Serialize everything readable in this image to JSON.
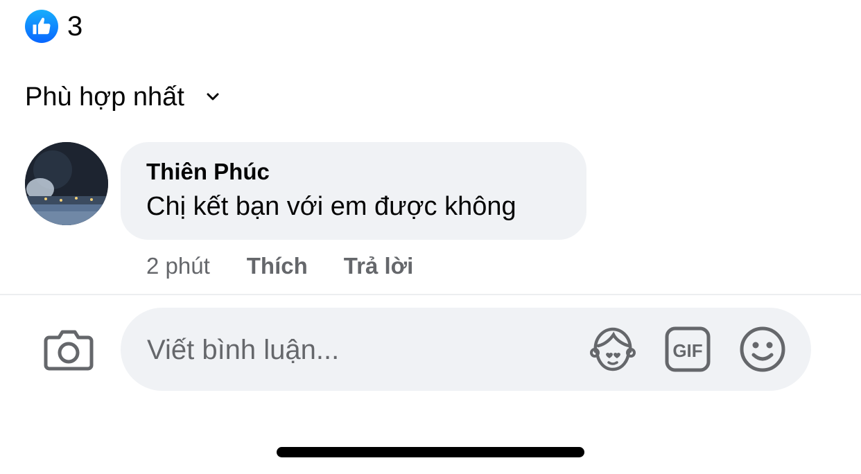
{
  "reactions": {
    "count": "3",
    "icon": "thumbs-up-icon",
    "color": "#0866ff"
  },
  "sort": {
    "label": "Phù hợp nhất",
    "icon": "chevron-down-icon"
  },
  "comment": {
    "author": "Thiên Phúc",
    "text": "Chị kết bạn với em được không",
    "time": "2 phút",
    "like_label": "Thích",
    "reply_label": "Trả lời"
  },
  "composer": {
    "placeholder": "Viết bình luận...",
    "value": "",
    "icons": [
      "camera-icon",
      "avatar-sticker-icon",
      "gif-icon",
      "emoji-icon"
    ]
  },
  "colors": {
    "bubble": "#f0f2f5",
    "secondary_text": "#65676b",
    "primary_text": "#050505"
  }
}
